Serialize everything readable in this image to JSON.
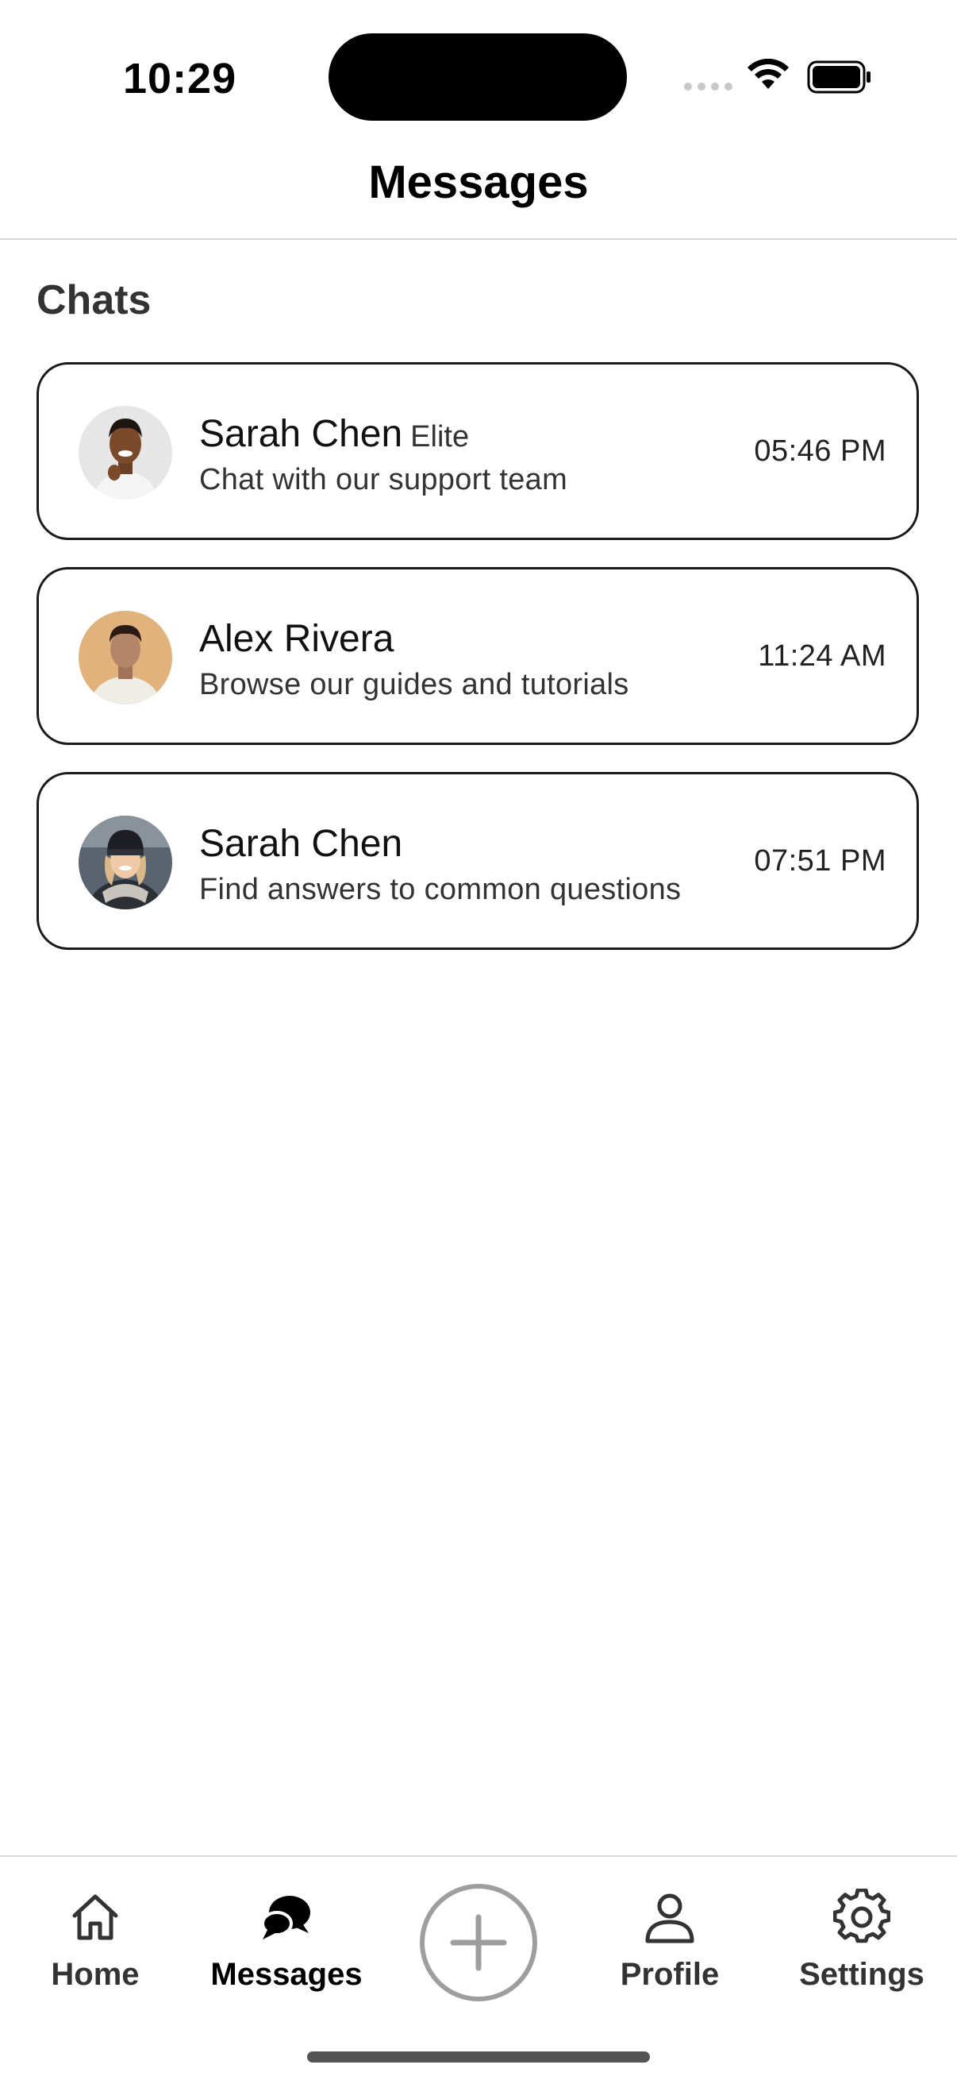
{
  "status_bar": {
    "time": "10:29"
  },
  "header": {
    "title": "Messages"
  },
  "section": {
    "title": "Chats"
  },
  "chats": [
    {
      "name": "Sarah Chen",
      "badge": "Elite",
      "preview": "Chat with our support team",
      "time": "05:46 PM",
      "avatar": "avatar-woman-smiling"
    },
    {
      "name": "Alex Rivera",
      "badge": "",
      "preview": "Browse our guides and tutorials",
      "time": "11:24 AM",
      "avatar": "avatar-man-tan-background"
    },
    {
      "name": "Sarah Chen",
      "badge": "",
      "preview": "Find answers to common questions",
      "time": "07:51 PM",
      "avatar": "avatar-woman-beanie"
    }
  ],
  "tab_bar": {
    "home": {
      "label": "Home",
      "icon": "house-icon"
    },
    "messages": {
      "label": "Messages",
      "icon": "chat-bubbles-icon"
    },
    "add": {
      "icon": "plus-circle-icon"
    },
    "profile": {
      "label": "Profile",
      "icon": "person-icon"
    },
    "settings": {
      "label": "Settings",
      "icon": "gear-icon"
    },
    "active_tab": "messages"
  },
  "colors": {
    "border": "#1a1a1a",
    "divider": "#d9d9d9",
    "add_button": "#9e9e9e"
  }
}
